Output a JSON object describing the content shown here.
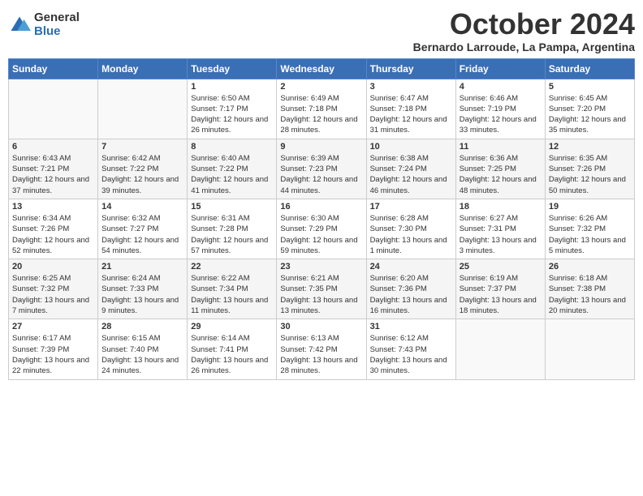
{
  "logo": {
    "general": "General",
    "blue": "Blue"
  },
  "title": "October 2024",
  "subtitle": "Bernardo Larroude, La Pampa, Argentina",
  "days_header": [
    "Sunday",
    "Monday",
    "Tuesday",
    "Wednesday",
    "Thursday",
    "Friday",
    "Saturday"
  ],
  "weeks": [
    [
      {
        "day": "",
        "info": ""
      },
      {
        "day": "",
        "info": ""
      },
      {
        "day": "1",
        "info": "Sunrise: 6:50 AM\nSunset: 7:17 PM\nDaylight: 12 hours and 26 minutes."
      },
      {
        "day": "2",
        "info": "Sunrise: 6:49 AM\nSunset: 7:18 PM\nDaylight: 12 hours and 28 minutes."
      },
      {
        "day": "3",
        "info": "Sunrise: 6:47 AM\nSunset: 7:18 PM\nDaylight: 12 hours and 31 minutes."
      },
      {
        "day": "4",
        "info": "Sunrise: 6:46 AM\nSunset: 7:19 PM\nDaylight: 12 hours and 33 minutes."
      },
      {
        "day": "5",
        "info": "Sunrise: 6:45 AM\nSunset: 7:20 PM\nDaylight: 12 hours and 35 minutes."
      }
    ],
    [
      {
        "day": "6",
        "info": "Sunrise: 6:43 AM\nSunset: 7:21 PM\nDaylight: 12 hours and 37 minutes."
      },
      {
        "day": "7",
        "info": "Sunrise: 6:42 AM\nSunset: 7:22 PM\nDaylight: 12 hours and 39 minutes."
      },
      {
        "day": "8",
        "info": "Sunrise: 6:40 AM\nSunset: 7:22 PM\nDaylight: 12 hours and 41 minutes."
      },
      {
        "day": "9",
        "info": "Sunrise: 6:39 AM\nSunset: 7:23 PM\nDaylight: 12 hours and 44 minutes."
      },
      {
        "day": "10",
        "info": "Sunrise: 6:38 AM\nSunset: 7:24 PM\nDaylight: 12 hours and 46 minutes."
      },
      {
        "day": "11",
        "info": "Sunrise: 6:36 AM\nSunset: 7:25 PM\nDaylight: 12 hours and 48 minutes."
      },
      {
        "day": "12",
        "info": "Sunrise: 6:35 AM\nSunset: 7:26 PM\nDaylight: 12 hours and 50 minutes."
      }
    ],
    [
      {
        "day": "13",
        "info": "Sunrise: 6:34 AM\nSunset: 7:26 PM\nDaylight: 12 hours and 52 minutes."
      },
      {
        "day": "14",
        "info": "Sunrise: 6:32 AM\nSunset: 7:27 PM\nDaylight: 12 hours and 54 minutes."
      },
      {
        "day": "15",
        "info": "Sunrise: 6:31 AM\nSunset: 7:28 PM\nDaylight: 12 hours and 57 minutes."
      },
      {
        "day": "16",
        "info": "Sunrise: 6:30 AM\nSunset: 7:29 PM\nDaylight: 12 hours and 59 minutes."
      },
      {
        "day": "17",
        "info": "Sunrise: 6:28 AM\nSunset: 7:30 PM\nDaylight: 13 hours and 1 minute."
      },
      {
        "day": "18",
        "info": "Sunrise: 6:27 AM\nSunset: 7:31 PM\nDaylight: 13 hours and 3 minutes."
      },
      {
        "day": "19",
        "info": "Sunrise: 6:26 AM\nSunset: 7:32 PM\nDaylight: 13 hours and 5 minutes."
      }
    ],
    [
      {
        "day": "20",
        "info": "Sunrise: 6:25 AM\nSunset: 7:32 PM\nDaylight: 13 hours and 7 minutes."
      },
      {
        "day": "21",
        "info": "Sunrise: 6:24 AM\nSunset: 7:33 PM\nDaylight: 13 hours and 9 minutes."
      },
      {
        "day": "22",
        "info": "Sunrise: 6:22 AM\nSunset: 7:34 PM\nDaylight: 13 hours and 11 minutes."
      },
      {
        "day": "23",
        "info": "Sunrise: 6:21 AM\nSunset: 7:35 PM\nDaylight: 13 hours and 13 minutes."
      },
      {
        "day": "24",
        "info": "Sunrise: 6:20 AM\nSunset: 7:36 PM\nDaylight: 13 hours and 16 minutes."
      },
      {
        "day": "25",
        "info": "Sunrise: 6:19 AM\nSunset: 7:37 PM\nDaylight: 13 hours and 18 minutes."
      },
      {
        "day": "26",
        "info": "Sunrise: 6:18 AM\nSunset: 7:38 PM\nDaylight: 13 hours and 20 minutes."
      }
    ],
    [
      {
        "day": "27",
        "info": "Sunrise: 6:17 AM\nSunset: 7:39 PM\nDaylight: 13 hours and 22 minutes."
      },
      {
        "day": "28",
        "info": "Sunrise: 6:15 AM\nSunset: 7:40 PM\nDaylight: 13 hours and 24 minutes."
      },
      {
        "day": "29",
        "info": "Sunrise: 6:14 AM\nSunset: 7:41 PM\nDaylight: 13 hours and 26 minutes."
      },
      {
        "day": "30",
        "info": "Sunrise: 6:13 AM\nSunset: 7:42 PM\nDaylight: 13 hours and 28 minutes."
      },
      {
        "day": "31",
        "info": "Sunrise: 6:12 AM\nSunset: 7:43 PM\nDaylight: 13 hours and 30 minutes."
      },
      {
        "day": "",
        "info": ""
      },
      {
        "day": "",
        "info": ""
      }
    ]
  ]
}
